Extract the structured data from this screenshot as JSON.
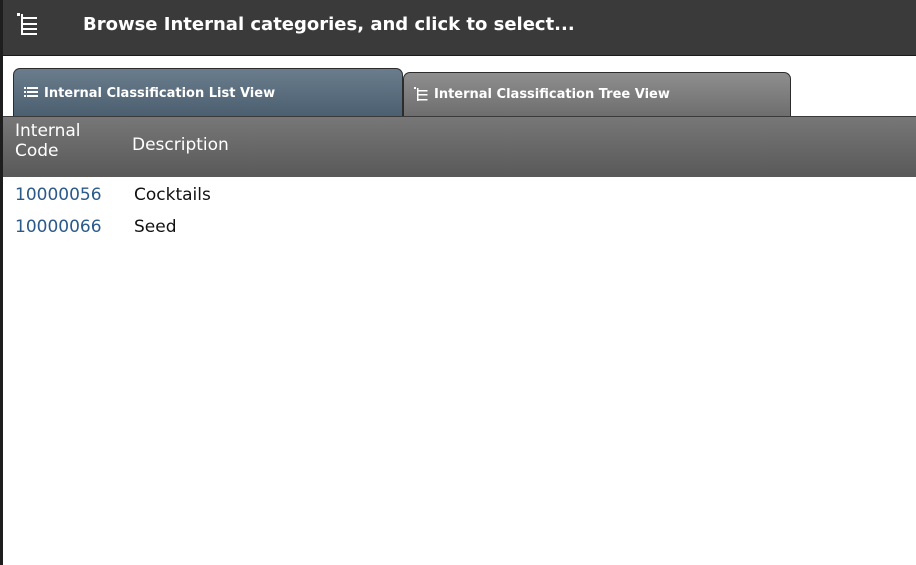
{
  "header": {
    "title": "Browse Internal categories, and click to select...",
    "icon": "tree-icon"
  },
  "tabs": [
    {
      "label": "Internal Classification List View",
      "icon": "list-icon",
      "active": true
    },
    {
      "label": "Internal Classification Tree View",
      "icon": "tree-icon",
      "active": false
    }
  ],
  "table": {
    "columns": [
      "Internal\nCode",
      "Description"
    ],
    "code_header_line1": "Internal",
    "code_header_line2": "Code",
    "description_header": "Description",
    "rows": [
      {
        "code": "10000056",
        "description": "Cocktails"
      },
      {
        "code": "10000066",
        "description": "Seed"
      }
    ]
  },
  "colors": {
    "titlebar": "#3a3a3a",
    "active_tab": "#566a7b",
    "inactive_tab": "#7a7a7a",
    "header_bg": "#666666",
    "code_text": "#2a5a8a"
  }
}
